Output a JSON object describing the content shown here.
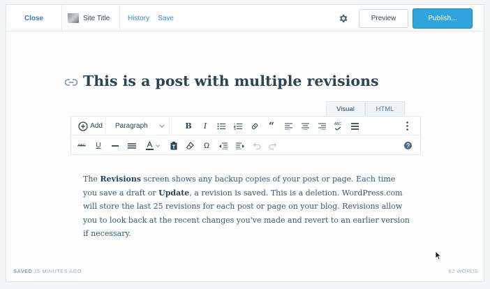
{
  "topbar": {
    "close_label": "Close",
    "site_title": "Site Title",
    "history_label": "History",
    "save_label": "Save",
    "preview_label": "Preview",
    "publish_label": "Publish..."
  },
  "post": {
    "title": "This is a post with multiple revisions"
  },
  "editor_tabs": [
    "Visual",
    "HTML"
  ],
  "toolbar": {
    "add_label": "Add",
    "format_value": "Paragraph",
    "spell_label": "ABC",
    "strike_label": "ABC"
  },
  "content": {
    "seg1": "The ",
    "seg2": "Revisions",
    "seg3": " screen shows any backup copies of your post or page. Each time you save a draft or ",
    "seg4": "Update",
    "seg5": ", a revision is saved. This is a deletion. WordPress.com will store the last 25 revisions for each post or page on your blog. Revisions allow you to look back at the recent changes you've made and revert to an earlier version if necessary."
  },
  "footer": {
    "saved_label": "SAVED",
    "saved_time": "25 MINUTES AGO",
    "word_count": "62 WORDS"
  },
  "colors": {
    "accent": "#2e8bc9",
    "publish": "#30a5dd",
    "text": "#2e4453"
  }
}
